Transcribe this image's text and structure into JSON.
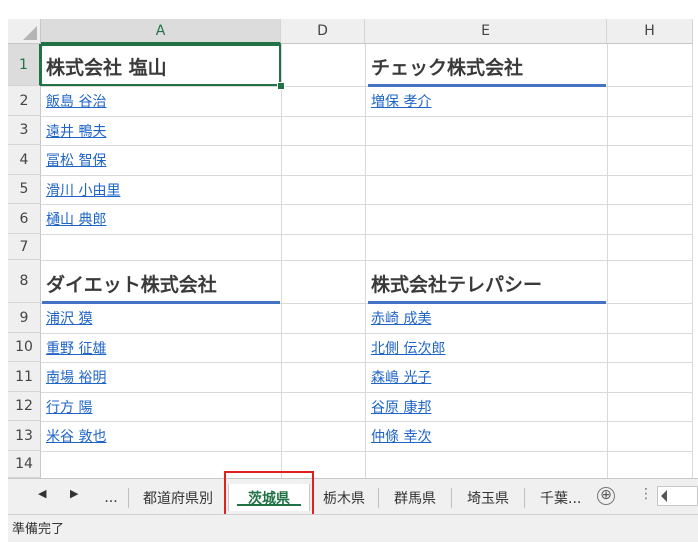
{
  "columns": [
    "A",
    "D",
    "E",
    "H"
  ],
  "rows": [
    "1",
    "2",
    "3",
    "4",
    "5",
    "6",
    "7",
    "8",
    "9",
    "10",
    "11",
    "12",
    "13",
    "14"
  ],
  "cells": {
    "a1": "株式会社 塩山",
    "e1": "チェック株式会社",
    "a2": "飯島 谷治",
    "a3": "遠井 鴨夫",
    "a4": "冨松 智保",
    "a5": "滑川 小由里",
    "a6": "樋山 典郎",
    "e2": "増保 孝介",
    "a8": "ダイエット株式会社",
    "e8": "株式会社テレパシー",
    "a9": "浦沢 獏",
    "a10": "重野 征雄",
    "a11": "南場 裕明",
    "a12": "行方 陽",
    "a13": "米谷 敦也",
    "e9": "赤崎 成美",
    "e10": "北側 伝次郎",
    "e11": "森嶋 光子",
    "e12": "谷原 康邦",
    "e13": "仲條 幸次"
  },
  "tabs": {
    "nav_ellipsis": "...",
    "items": [
      "都道府県別",
      "茨城県",
      "栃木県",
      "群馬県",
      "埼玉県",
      "千葉..."
    ],
    "active": "茨城県",
    "add": "⊕"
  },
  "status": {
    "text": "準備完了"
  },
  "colors": {
    "accent": "#217346",
    "link": "#1f64c8",
    "border_blue": "#4472c4",
    "highlight_red": "#e02020"
  }
}
